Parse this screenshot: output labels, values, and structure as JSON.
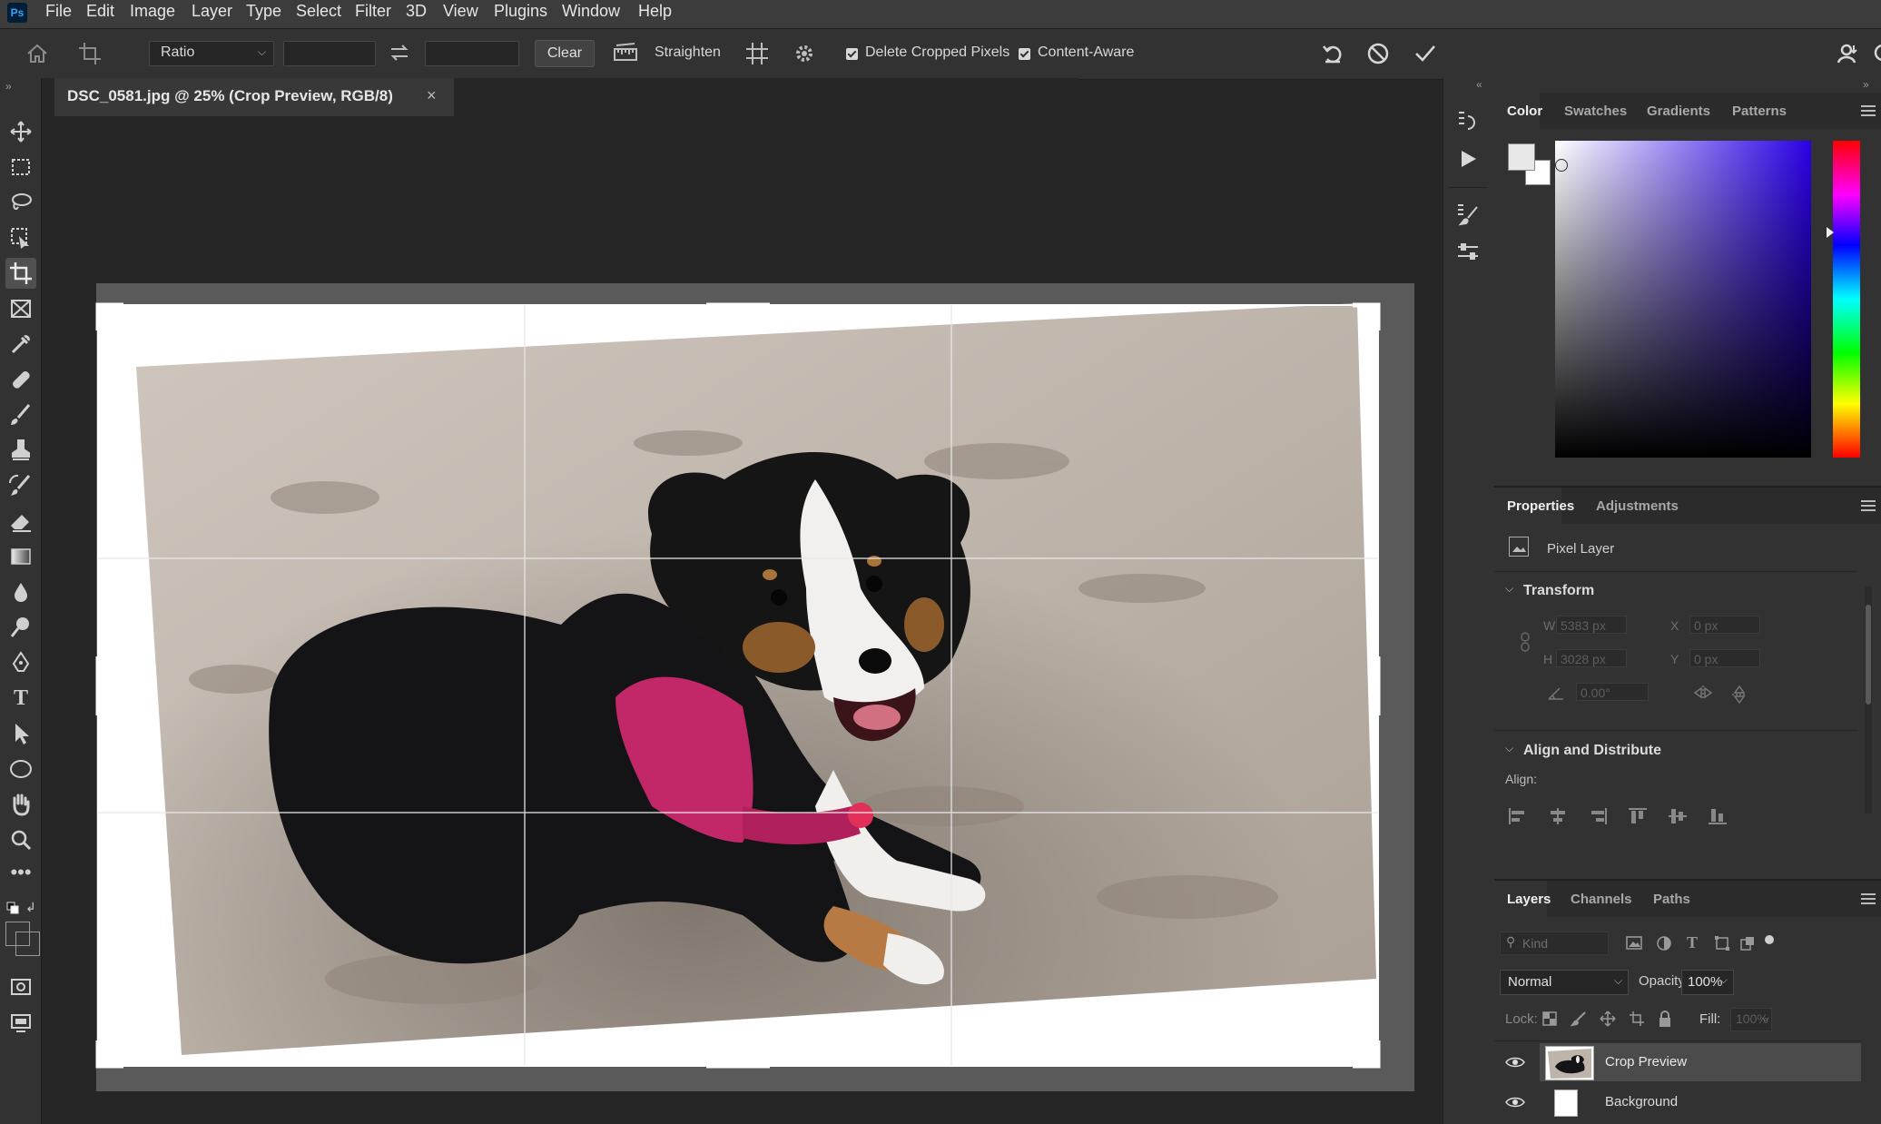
{
  "app": {
    "logo": "Ps"
  },
  "menu": [
    "File",
    "Edit",
    "Image",
    "Layer",
    "Type",
    "Select",
    "Filter",
    "3D",
    "View",
    "Plugins",
    "Window",
    "Help"
  ],
  "options": {
    "ratio_value": "Ratio",
    "clear_label": "Clear",
    "straighten_label": "Straighten",
    "delete_cropped_label": "Delete Cropped Pixels",
    "content_aware_label": "Content-Aware"
  },
  "document": {
    "tab_title": "DSC_0581.jpg @ 25% (Crop Preview, RGB/8)",
    "close_glyph": "×"
  },
  "color_panel": {
    "tabs": [
      "Color",
      "Swatches",
      "Gradients",
      "Patterns"
    ],
    "fg_color": "#e8e8e8",
    "bg_color": "#ffffff"
  },
  "properties_panel": {
    "tabs": [
      "Properties",
      "Adjustments"
    ],
    "layer_kind": "Pixel Layer",
    "transform_title": "Transform",
    "w_label": "W",
    "w_value": "5383 px",
    "h_label": "H",
    "h_value": "3028 px",
    "x_label": "X",
    "x_value": "0 px",
    "y_label": "Y",
    "y_value": "0 px",
    "angle_value": "0.00°",
    "align_title": "Align and Distribute",
    "align_label": "Align:"
  },
  "layers_panel": {
    "tabs": [
      "Layers",
      "Channels",
      "Paths"
    ],
    "kind_placeholder": "Kind",
    "blend_mode": "Normal",
    "opacity_label": "Opacity:",
    "opacity_value": "100%",
    "lock_label": "Lock:",
    "fill_label": "Fill:",
    "fill_value": "100%",
    "layers": [
      "Crop Preview",
      "Background"
    ]
  }
}
